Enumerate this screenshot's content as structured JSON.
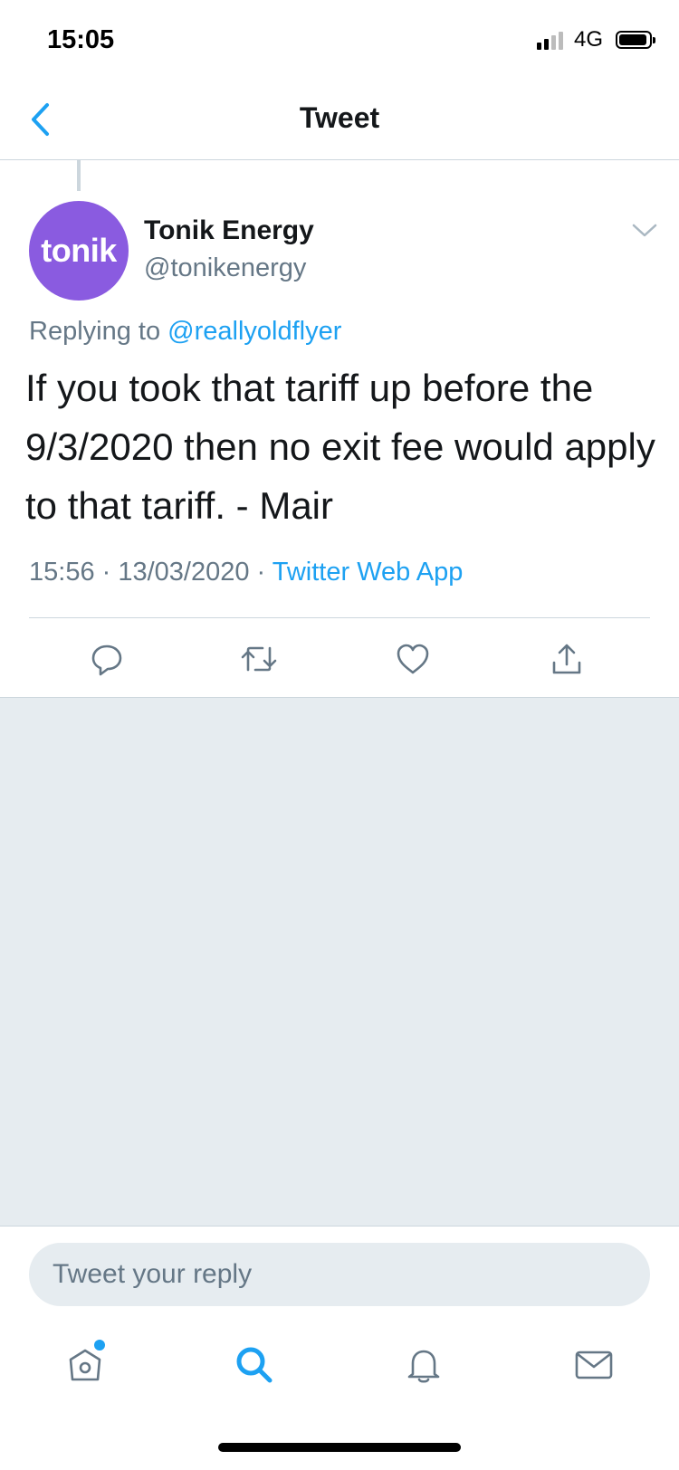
{
  "status_bar": {
    "time": "15:05",
    "network": "4G"
  },
  "nav": {
    "title": "Tweet"
  },
  "tweet": {
    "avatar_text": "tonik",
    "display_name": "Tonik Energy",
    "handle": "@tonikenergy",
    "replying_prefix": "Replying to",
    "replying_to": "@reallyoldflyer",
    "text": "If you took that tariff up before the 9/3/2020 then no exit fee would apply to that tariff. - Mair",
    "timestamp": "15:56 · 13/03/2020 · ",
    "source": "Twitter Web App"
  },
  "reply": {
    "placeholder": "Tweet your reply"
  },
  "colors": {
    "accent": "#1da1f2",
    "avatar_bg": "#8a5be0",
    "muted": "#657786",
    "gray_area": "#e6ecf0"
  },
  "icons": {
    "actions": [
      "reply-icon",
      "retweet-icon",
      "like-icon",
      "share-icon"
    ],
    "tabs": [
      "home-icon",
      "search-icon",
      "notifications-icon",
      "messages-icon"
    ]
  }
}
